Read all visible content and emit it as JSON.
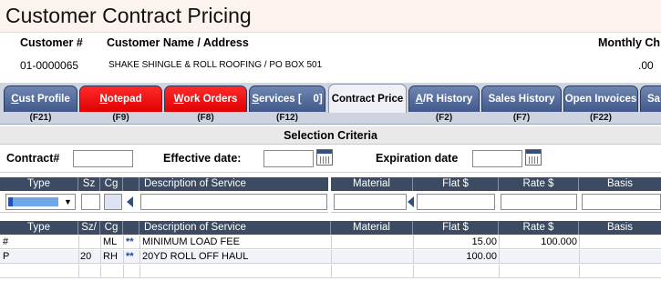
{
  "title": "Customer Contract Pricing",
  "customer": {
    "number_header": "Customer #",
    "name_header": "Customer Name / Address",
    "monthly_header": "Monthly Ch",
    "number": "01-0000065",
    "name_address": "SHAKE SHINGLE & ROLL ROOFING  /  PO BOX 501",
    "monthly": ".00"
  },
  "tabs": [
    {
      "pre": "",
      "u": "C",
      "post": "ust Profile",
      "key": "(F21)",
      "style": "blue"
    },
    {
      "pre": "",
      "u": "N",
      "post": "otepad",
      "key": "(F9)",
      "style": "red"
    },
    {
      "pre": "",
      "u": "W",
      "post": "ork Orders",
      "key": "(F8)",
      "style": "red"
    },
    {
      "pre": "",
      "u": "S",
      "post": "ervices [    0]",
      "key": "(F12)",
      "style": "blue"
    },
    {
      "pre": "",
      "u": "",
      "post": "Contract Price",
      "key": "",
      "style": "active"
    },
    {
      "pre": "",
      "u": "A",
      "post": "/R History",
      "key": "(F2)",
      "style": "blue"
    },
    {
      "pre": "",
      "u": "",
      "post": "Sales History",
      "key": "(F7)",
      "style": "blue"
    },
    {
      "pre": "",
      "u": "",
      "post": "Open Invoices",
      "key": "(F22)",
      "style": "blue"
    },
    {
      "pre": "",
      "u": "",
      "post": "Sa",
      "key": "",
      "style": "blue"
    }
  ],
  "selection": {
    "title": "Selection Criteria",
    "contract_label": "Contract#",
    "contract_value": "",
    "effective_label": "Effective date:",
    "effective_value": "",
    "expiration_label": "Expiration date",
    "expiration_value": ""
  },
  "columns": {
    "type": "Type",
    "size": "Sz",
    "size_alt": "Sz/",
    "container": "Cg",
    "description": "Description of Service",
    "material": "Material",
    "flat": "Flat $",
    "rate": "Rate $",
    "basis": "Basis"
  },
  "rows": [
    {
      "type": "#",
      "size": "",
      "container": "ML",
      "flag": "**",
      "description": "MINIMUM LOAD FEE",
      "material": "",
      "flat": "15.00",
      "rate": "100.000",
      "basis": ""
    },
    {
      "type": "P",
      "size": "20",
      "container": "RH",
      "flag": "**",
      "description": "20YD ROLL OFF HAUL",
      "material": "",
      "flat": "100.00",
      "rate": "",
      "basis": ""
    }
  ],
  "colors": {
    "header_bg": "#3c4a62",
    "tab_blue": "#41598a",
    "tab_red": "#e00000",
    "accent": "#304f84"
  }
}
